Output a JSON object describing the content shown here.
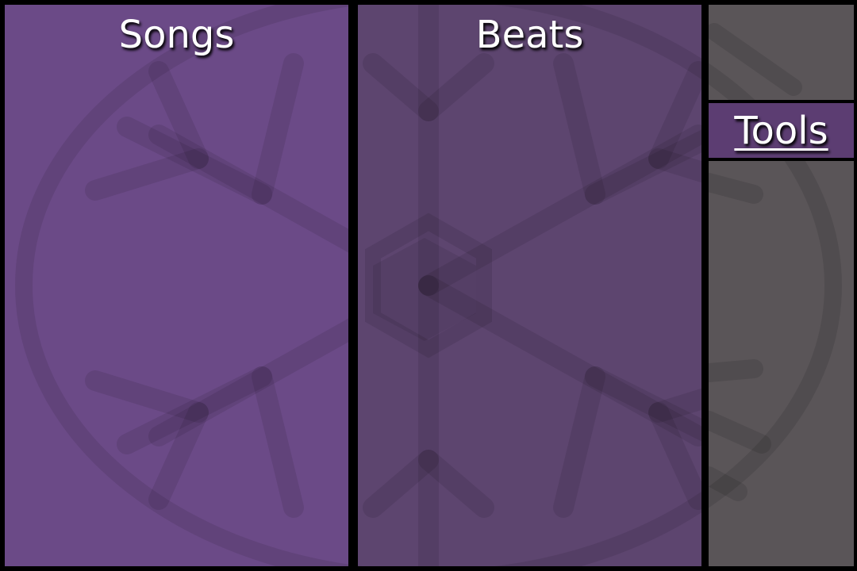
{
  "panels": {
    "songs": {
      "title": "Songs"
    },
    "beats": {
      "title": "Beats"
    }
  },
  "tools": {
    "label": "Tools"
  },
  "background": {
    "decoration": "snowflake-emblem"
  },
  "colors": {
    "frame": "#000000",
    "songs_panel": "#6b4a87",
    "beats_panel": "#5d456f",
    "tools_tab": "#5c3d72",
    "gray_panel": "#5a5558",
    "text": "#ffffff"
  }
}
